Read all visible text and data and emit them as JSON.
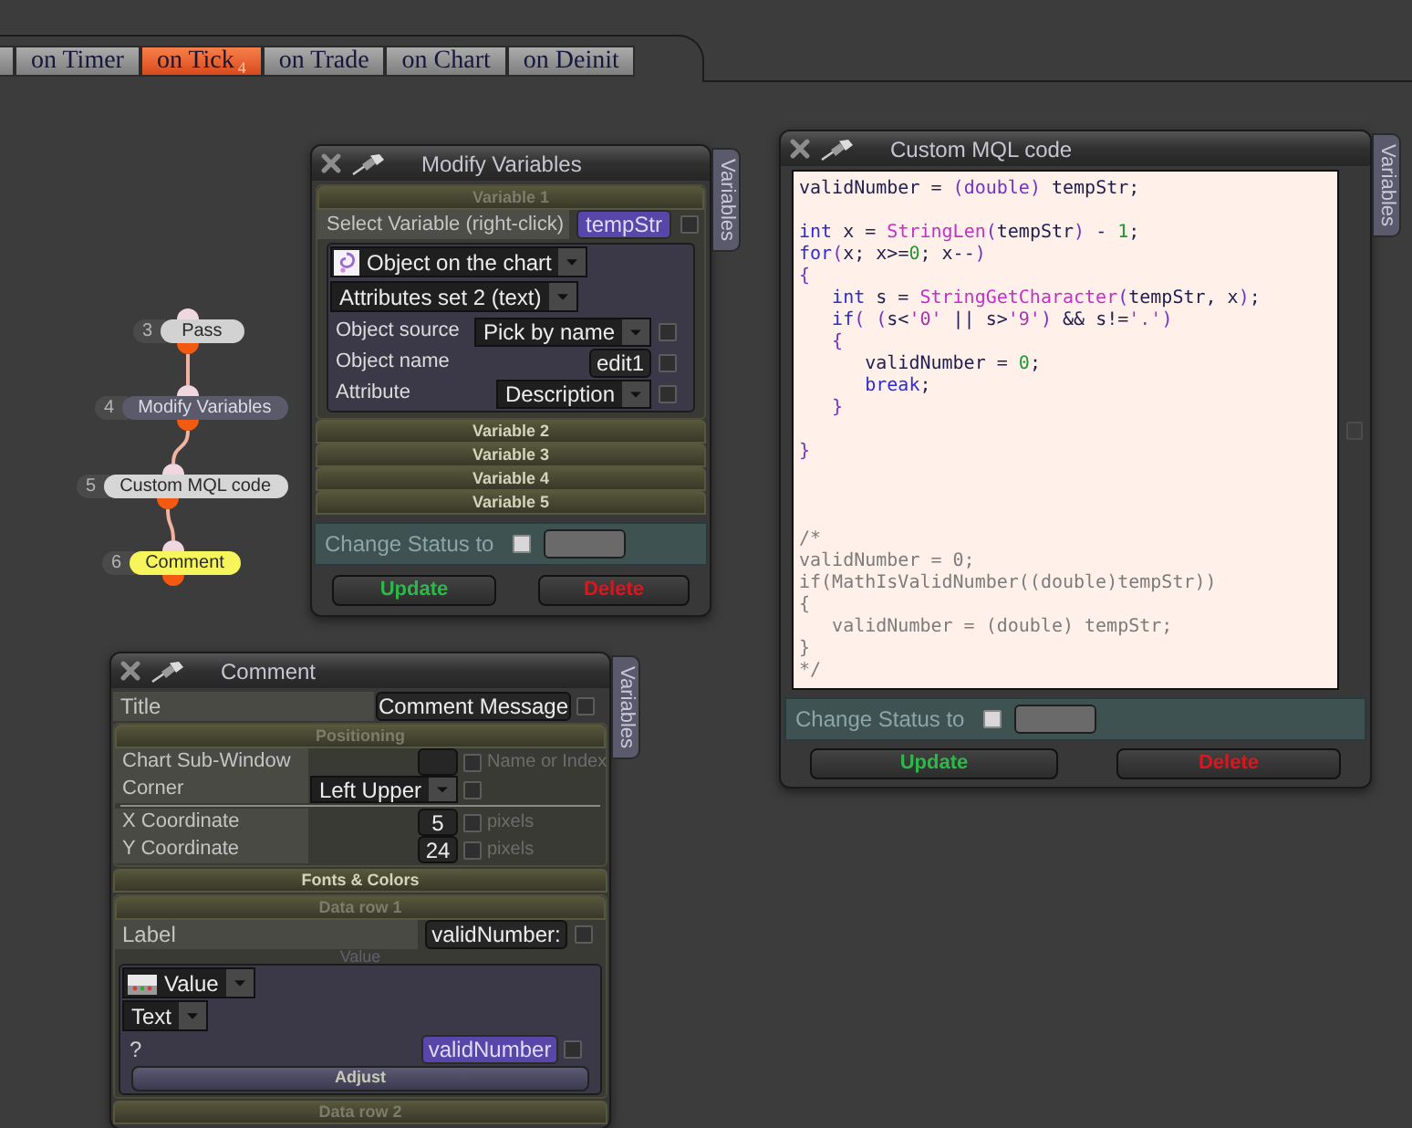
{
  "tab_bar": {
    "tabs": [
      {
        "label": "on Timer",
        "selected": false
      },
      {
        "label": "on Tick",
        "badge": "4",
        "selected": true
      },
      {
        "label": "on Trade",
        "selected": false
      },
      {
        "label": "on Chart",
        "selected": false
      },
      {
        "label": "on Deinit",
        "selected": false
      }
    ]
  },
  "flow_nodes": [
    {
      "number": "3",
      "label": "Pass",
      "color": "#d2d2d2"
    },
    {
      "number": "4",
      "label": "Modify Variables",
      "color": "#5a5a6a"
    },
    {
      "number": "5",
      "label": "Custom MQL code",
      "color": "#d6d6d6"
    },
    {
      "number": "6",
      "label": "Comment",
      "color": "#f6f65c"
    }
  ],
  "modify_variables_window": {
    "title": "Modify Variables",
    "side_tab": "Variables",
    "sections": [
      {
        "title": "Variable 1",
        "expanded": true,
        "select_label": "Select Variable (right-click)",
        "variable": "tempStr",
        "checked": false,
        "object_type": "Object on the chart",
        "attribute_set": "Attributes set 2 (text)",
        "fields": [
          {
            "kind": "dropdown",
            "label": "Object source",
            "value": "Pick by name",
            "checked": false
          },
          {
            "kind": "text",
            "label": "Object name",
            "value": "edit1",
            "checked": false
          },
          {
            "kind": "dropdown",
            "label": "Attribute",
            "value": "Description",
            "checked": false
          }
        ]
      },
      {
        "title": "Variable 2",
        "expanded": false
      },
      {
        "title": "Variable 3",
        "expanded": false
      },
      {
        "title": "Variable 4",
        "expanded": false
      },
      {
        "title": "Variable 5",
        "expanded": false
      }
    ],
    "change_status": {
      "label": "Change Status to",
      "checked": false
    },
    "buttons": [
      {
        "label": "Update",
        "kind": "update"
      },
      {
        "label": "Delete",
        "kind": "delete"
      }
    ]
  },
  "custom_code_window": {
    "title": "Custom MQL code",
    "side_tab": "Variables",
    "code": [
      {
        "kind": "code",
        "tokens": [
          {
            "kind": "text",
            "text": "validNumber = "
          },
          {
            "kind": "bracket",
            "text": "(double)"
          },
          {
            "kind": "text",
            "text": " tempStr;"
          }
        ]
      },
      {
        "kind": "blank"
      },
      {
        "kind": "code",
        "tokens": [
          {
            "kind": "keyword",
            "text": "int"
          },
          {
            "kind": "text",
            "text": " x = "
          },
          {
            "kind": "function",
            "text": "StringLen"
          },
          {
            "kind": "bracket",
            "text": "("
          },
          {
            "kind": "text",
            "text": "tempStr"
          },
          {
            "kind": "bracket",
            "text": ")"
          },
          {
            "kind": "text",
            "text": " - "
          },
          {
            "kind": "number",
            "text": "1"
          },
          {
            "kind": "text",
            "text": ";"
          }
        ]
      },
      {
        "kind": "code",
        "tokens": [
          {
            "kind": "keyword",
            "text": "for"
          },
          {
            "kind": "bracket",
            "text": "("
          },
          {
            "kind": "text",
            "text": "x; x>="
          },
          {
            "kind": "number",
            "text": "0"
          },
          {
            "kind": "text",
            "text": "; x--"
          },
          {
            "kind": "bracket",
            "text": ")"
          }
        ]
      },
      {
        "kind": "code",
        "tokens": [
          {
            "kind": "bracket",
            "text": "{"
          }
        ]
      },
      {
        "kind": "code",
        "tokens": [
          {
            "kind": "keyword",
            "text": "   int"
          },
          {
            "kind": "text",
            "text": " s = "
          },
          {
            "kind": "function",
            "text": "StringGetCharacter"
          },
          {
            "kind": "bracket",
            "text": "("
          },
          {
            "kind": "text",
            "text": "tempStr, x"
          },
          {
            "kind": "bracket",
            "text": ")"
          },
          {
            "kind": "text",
            "text": ";"
          }
        ]
      },
      {
        "kind": "code",
        "tokens": [
          {
            "kind": "keyword",
            "text": "   if"
          },
          {
            "kind": "bracket",
            "text": "( ("
          },
          {
            "kind": "text",
            "text": "s<"
          },
          {
            "kind": "string",
            "text": "'0'"
          },
          {
            "kind": "text",
            "text": " || s>"
          },
          {
            "kind": "string",
            "text": "'9'"
          },
          {
            "kind": "bracket",
            "text": ")"
          },
          {
            "kind": "text",
            "text": " && s!="
          },
          {
            "kind": "string",
            "text": "'.'"
          },
          {
            "kind": "bracket",
            "text": ")"
          }
        ]
      },
      {
        "kind": "code",
        "tokens": [
          {
            "kind": "bracket",
            "text": "   {"
          }
        ]
      },
      {
        "kind": "code",
        "tokens": [
          {
            "kind": "text",
            "text": "      validNumber = "
          },
          {
            "kind": "number",
            "text": "0"
          },
          {
            "kind": "text",
            "text": ";"
          }
        ]
      },
      {
        "kind": "code",
        "tokens": [
          {
            "kind": "keyword",
            "text": "      break"
          },
          {
            "kind": "text",
            "text": ";"
          }
        ]
      },
      {
        "kind": "code",
        "tokens": [
          {
            "kind": "bracket",
            "text": "   }"
          }
        ]
      },
      {
        "kind": "blank"
      },
      {
        "kind": "code",
        "tokens": [
          {
            "kind": "bracket",
            "text": "}"
          }
        ]
      },
      {
        "kind": "blank"
      },
      {
        "kind": "blank"
      },
      {
        "kind": "blank"
      },
      {
        "kind": "code",
        "tokens": [
          {
            "kind": "comment",
            "text": "/*"
          }
        ]
      },
      {
        "kind": "code",
        "tokens": [
          {
            "kind": "comment",
            "text": "validNumber = 0;"
          }
        ]
      },
      {
        "kind": "code",
        "tokens": [
          {
            "kind": "comment",
            "text": "if(MathIsValidNumber((double)tempStr))"
          }
        ]
      },
      {
        "kind": "code",
        "tokens": [
          {
            "kind": "comment",
            "text": "{"
          }
        ]
      },
      {
        "kind": "code",
        "tokens": [
          {
            "kind": "comment",
            "text": "   validNumber = (double) tempStr;"
          }
        ]
      },
      {
        "kind": "code",
        "tokens": [
          {
            "kind": "comment",
            "text": "}"
          }
        ]
      },
      {
        "kind": "code",
        "tokens": [
          {
            "kind": "comment",
            "text": "*/"
          }
        ]
      }
    ],
    "change_status": {
      "label": "Change Status to",
      "checked": false
    },
    "buttons": [
      {
        "label": "Update",
        "kind": "update"
      },
      {
        "label": "Delete",
        "kind": "delete"
      }
    ]
  },
  "comment_window": {
    "title": "Comment",
    "side_tab": "Variables",
    "title_field": {
      "label": "Title",
      "value": "Comment Message",
      "checked": false
    },
    "sections": [
      {
        "title": "Positioning",
        "expanded": true,
        "rows": [
          {
            "kind": "text",
            "label": "Chart Sub-Window",
            "checked": false,
            "note": "Name or Index"
          },
          {
            "kind": "dropdown",
            "label": "Corner",
            "value": "Left Upper",
            "checked": false
          },
          {
            "kind": "divider"
          },
          {
            "kind": "text",
            "label": "X Coordinate",
            "value": "5",
            "checked": false,
            "note": "pixels"
          },
          {
            "kind": "text",
            "label": "Y Coordinate",
            "value": "24",
            "checked": false,
            "note": "pixels"
          }
        ]
      },
      {
        "title": "Fonts & Colors",
        "expanded": false
      },
      {
        "title": "Data row 1",
        "expanded": true,
        "label_field": {
          "label": "Label",
          "value": "validNumber:",
          "checked": false
        },
        "value_caption": "Value",
        "value_source": "Value",
        "format": "Text",
        "variable_field": {
          "label": "?",
          "value": "validNumber",
          "checked": false
        },
        "adjust_button": "Adjust"
      },
      {
        "title": "Data row 2",
        "expanded": true
      }
    ]
  }
}
